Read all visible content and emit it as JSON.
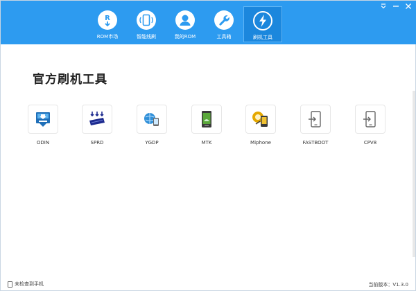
{
  "nav": [
    {
      "label": "ROM市场",
      "icon": "rom-market-icon"
    },
    {
      "label": "智能线刷",
      "icon": "smart-flash-icon"
    },
    {
      "label": "我的ROM",
      "icon": "user-icon"
    },
    {
      "label": "工具箱",
      "icon": "wrench-icon"
    },
    {
      "label": "刷机工具",
      "icon": "lightning-icon",
      "active": true
    }
  ],
  "page_title": "官方刷机工具",
  "tools": [
    {
      "label": "ODIN",
      "icon": "odin-icon"
    },
    {
      "label": "SPRD",
      "icon": "sprd-icon"
    },
    {
      "label": "YGDP",
      "icon": "ygdp-icon"
    },
    {
      "label": "MTK",
      "icon": "mtk-icon"
    },
    {
      "label": "Miphone",
      "icon": "miphone-icon"
    },
    {
      "label": "FASTBOOT",
      "icon": "fastboot-icon"
    },
    {
      "label": "CPV8",
      "icon": "cpv8-icon"
    }
  ],
  "footer": {
    "status": "未检查到手机",
    "version": "当前版本：V1.3.0"
  },
  "colors": {
    "accent": "#2d9bf0",
    "active": "#1b87dd"
  }
}
